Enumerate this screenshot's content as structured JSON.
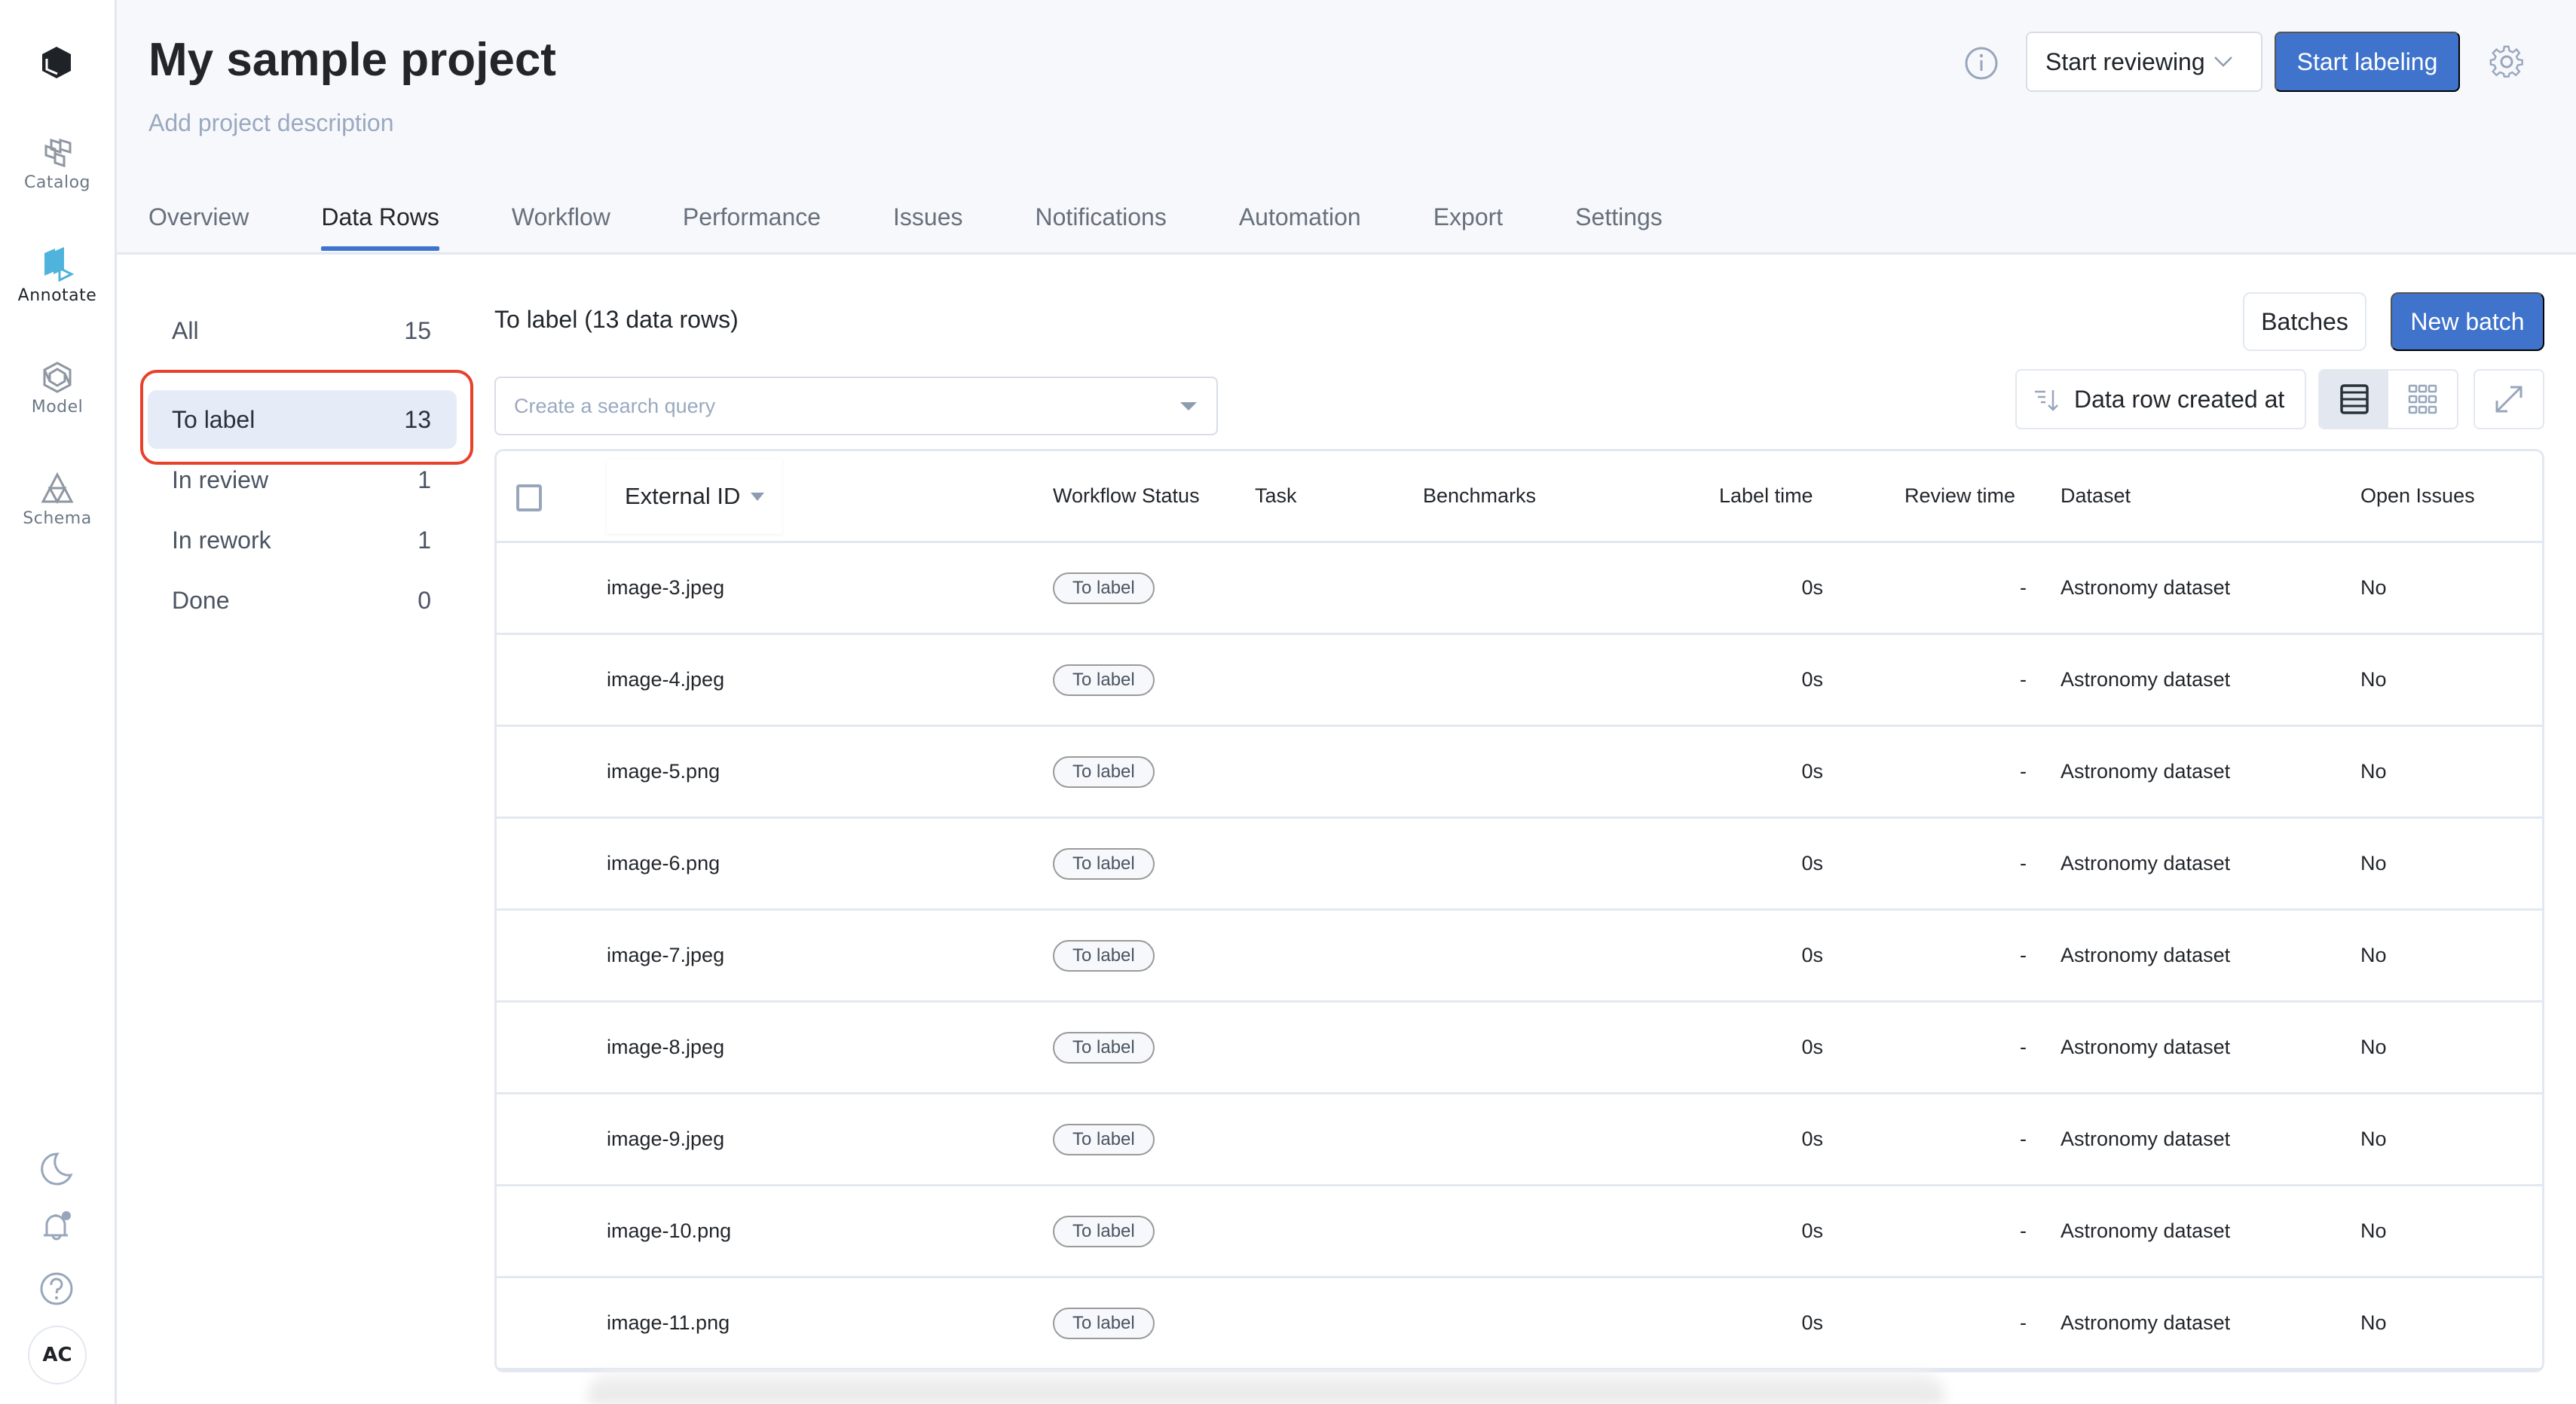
{
  "sidebar": {
    "logo": "labelbox-logo-icon",
    "items": [
      {
        "label": "Catalog",
        "icon": "catalog-icon",
        "active": false
      },
      {
        "label": "Annotate",
        "icon": "annotate-icon",
        "active": true
      },
      {
        "label": "Model",
        "icon": "model-icon",
        "active": false
      },
      {
        "label": "Schema",
        "icon": "schema-icon",
        "active": false
      }
    ],
    "bottom_icons": [
      "moon-icon",
      "bell-icon",
      "help-icon"
    ],
    "avatar_initials": "AC"
  },
  "header": {
    "title": "My sample project",
    "description_placeholder": "Add project description",
    "start_reviewing_label": "Start reviewing",
    "start_labeling_label": "Start labeling"
  },
  "tabs": [
    {
      "label": "Overview",
      "active": false
    },
    {
      "label": "Data Rows",
      "active": true
    },
    {
      "label": "Workflow",
      "active": false
    },
    {
      "label": "Performance",
      "active": false
    },
    {
      "label": "Issues",
      "active": false
    },
    {
      "label": "Notifications",
      "active": false
    },
    {
      "label": "Automation",
      "active": false
    },
    {
      "label": "Export",
      "active": false
    },
    {
      "label": "Settings",
      "active": false
    }
  ],
  "filters": [
    {
      "label": "All",
      "count": "15",
      "active": false
    },
    {
      "label": "To label",
      "count": "13",
      "active": true
    },
    {
      "label": "In review",
      "count": "1",
      "active": false
    },
    {
      "label": "In rework",
      "count": "1",
      "active": false
    },
    {
      "label": "Done",
      "count": "0",
      "active": false
    }
  ],
  "list": {
    "title": "To label  (13 data rows)",
    "batches_label": "Batches",
    "new_batch_label": "New batch",
    "search_placeholder": "Create a search query",
    "search_value": "",
    "sort_label": "Data row created at",
    "view_mode": "list"
  },
  "table": {
    "columns": [
      "External ID",
      "Workflow Status",
      "Task",
      "Benchmarks",
      "Label time",
      "Review time",
      "Dataset",
      "Open Issues"
    ],
    "rows": [
      {
        "external_id": "image-3.jpeg",
        "status": "To label",
        "task": "",
        "benchmarks": "",
        "label_time": "0s",
        "review_time": "-",
        "dataset": "Astronomy dataset",
        "open_issues": "No"
      },
      {
        "external_id": "image-4.jpeg",
        "status": "To label",
        "task": "",
        "benchmarks": "",
        "label_time": "0s",
        "review_time": "-",
        "dataset": "Astronomy dataset",
        "open_issues": "No"
      },
      {
        "external_id": "image-5.png",
        "status": "To label",
        "task": "",
        "benchmarks": "",
        "label_time": "0s",
        "review_time": "-",
        "dataset": "Astronomy dataset",
        "open_issues": "No"
      },
      {
        "external_id": "image-6.png",
        "status": "To label",
        "task": "",
        "benchmarks": "",
        "label_time": "0s",
        "review_time": "-",
        "dataset": "Astronomy dataset",
        "open_issues": "No"
      },
      {
        "external_id": "image-7.jpeg",
        "status": "To label",
        "task": "",
        "benchmarks": "",
        "label_time": "0s",
        "review_time": "-",
        "dataset": "Astronomy dataset",
        "open_issues": "No"
      },
      {
        "external_id": "image-8.jpeg",
        "status": "To label",
        "task": "",
        "benchmarks": "",
        "label_time": "0s",
        "review_time": "-",
        "dataset": "Astronomy dataset",
        "open_issues": "No"
      },
      {
        "external_id": "image-9.jpeg",
        "status": "To label",
        "task": "",
        "benchmarks": "",
        "label_time": "0s",
        "review_time": "-",
        "dataset": "Astronomy dataset",
        "open_issues": "No"
      },
      {
        "external_id": "image-10.png",
        "status": "To label",
        "task": "",
        "benchmarks": "",
        "label_time": "0s",
        "review_time": "-",
        "dataset": "Astronomy dataset",
        "open_issues": "No"
      },
      {
        "external_id": "image-11.png",
        "status": "To label",
        "task": "",
        "benchmarks": "",
        "label_time": "0s",
        "review_time": "-",
        "dataset": "Astronomy dataset",
        "open_issues": "No"
      }
    ]
  },
  "colors": {
    "accent": "#3f73cc",
    "annotate_icon": "#4fb3db",
    "highlight_outline": "#e8412b",
    "active_filter_bg": "#e6ecf7",
    "header_bg": "#f7f8fc"
  }
}
